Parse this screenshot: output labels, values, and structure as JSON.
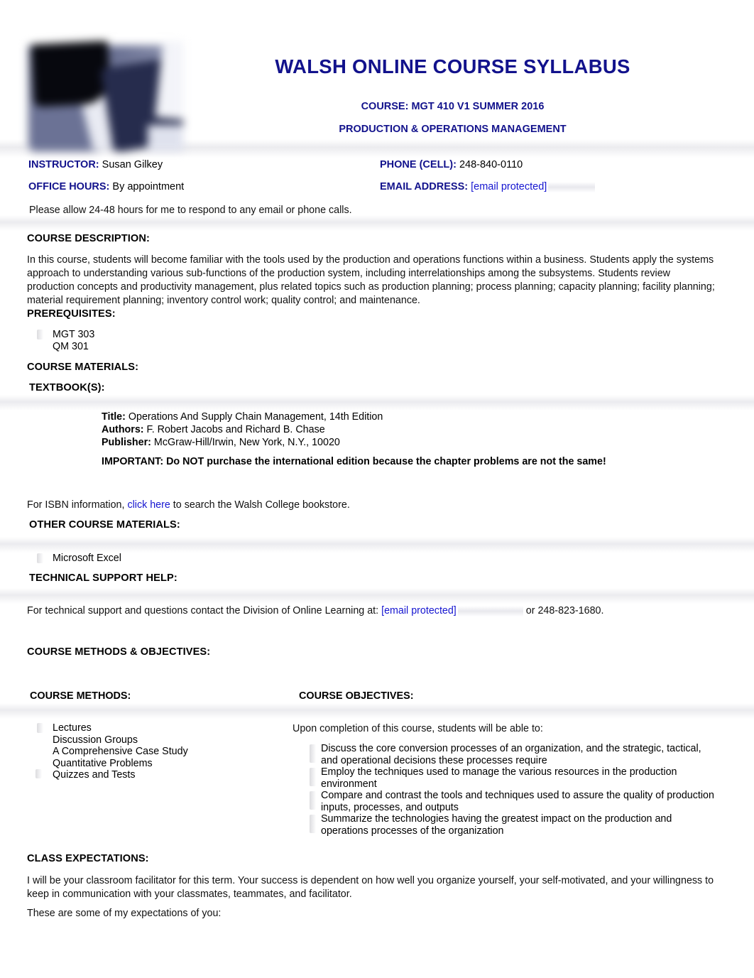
{
  "document": {
    "title": "WALSH ONLINE COURSE SYLLABUS",
    "course_line": "COURSE: MGT 410 V1  SUMMER 2016",
    "course_subject": "PRODUCTION & OPERATIONS MANAGEMENT",
    "logo_alt": "walsh-college-logo-image"
  },
  "colors": {
    "heading_blue": "#12128c",
    "link_blue": "#1515d0",
    "body_black": "#000000"
  },
  "info": {
    "instructor_label": "INSTRUCTOR:",
    "instructor_value": "Susan Gilkey",
    "phone_label": "PHONE (CELL):",
    "phone_value": "248-840-0110",
    "office_hours_label": "OFFICE HOURS:",
    "office_hours_value": "By appointment",
    "email_label": "EMAIL ADDRESS:",
    "email_value": "[email protected]",
    "response_note": "Please allow 24-48 hours for me to respond to any email or phone calls."
  },
  "course_description": {
    "heading": "COURSE DESCRIPTION:",
    "text": "In this course, students will become familiar with the tools used by the production and operations functions within a business. Students apply the systems approach to understanding various sub-functions of the production system, including interrelationships among the subsystems. Students review production concepts and productivity management, plus related topics such as production planning; process planning; capacity planning; facility planning; material requirement planning; inventory control work; quality control; and maintenance."
  },
  "prerequisites": {
    "heading": "PREREQUISITES:",
    "items": [
      "MGT 303",
      "QM 301"
    ]
  },
  "course_materials": {
    "heading": "COURSE MATERIALS:",
    "textbook_heading": "TEXTBOOK(S):",
    "textbook": {
      "title_label": "Title:",
      "title_value": "Operations And Supply Chain Management, 14th Edition",
      "authors_label": "Authors:",
      "authors_value": "F. Robert Jacobs and Richard B. Chase",
      "publisher_label": "Publisher:",
      "publisher_value": "McGraw-Hill/Irwin, New York, N.Y., 10020",
      "important": "IMPORTANT: Do NOT purchase the international edition because the chapter problems are not the same!"
    },
    "isbn_note_pre": "For ISBN information, ",
    "isbn_link": "click here",
    "isbn_note_post": " to search the Walsh College bookstore.",
    "other_heading": "OTHER COURSE MATERIALS:",
    "other_items": [
      "Microsoft Excel"
    ]
  },
  "technical_support": {
    "heading": "TECHNICAL SUPPORT HELP:",
    "text_pre": "For technical support and questions contact the Division of Online Learning at: ",
    "email": "[email protected]",
    "text_post": " or 248-823-1680."
  },
  "methods_objectives": {
    "heading": "COURSE METHODS & OBJECTIVES:",
    "methods_heading": "COURSE METHODS:",
    "methods": [
      "Lectures",
      "Discussion Groups",
      "A Comprehensive Case Study",
      "Quantitative Problems",
      "Quizzes and Tests"
    ],
    "objectives_heading": "COURSE OBJECTIVES:",
    "objectives_intro": "Upon completion of this course, students will be able to:",
    "objectives": [
      "Discuss the core conversion processes of an organization, and the strategic, tactical, and operational decisions these processes require",
      "Employ the techniques used to manage the various resources in the production environment",
      "Compare and contrast the tools and techniques used to assure the quality of production inputs, processes, and outputs",
      "Summarize the technologies having the greatest impact on the production and operations processes of the organization"
    ]
  },
  "class_expectations": {
    "heading": "CLASS EXPECTATIONS:",
    "paragraph": "I will be your classroom facilitator for this term. Your success is dependent on how well you organize yourself, your self-motivated, and your willingness to keep in communication with your classmates, teammates, and facilitator.",
    "lead_in": "These are some of my expectations of you:"
  }
}
